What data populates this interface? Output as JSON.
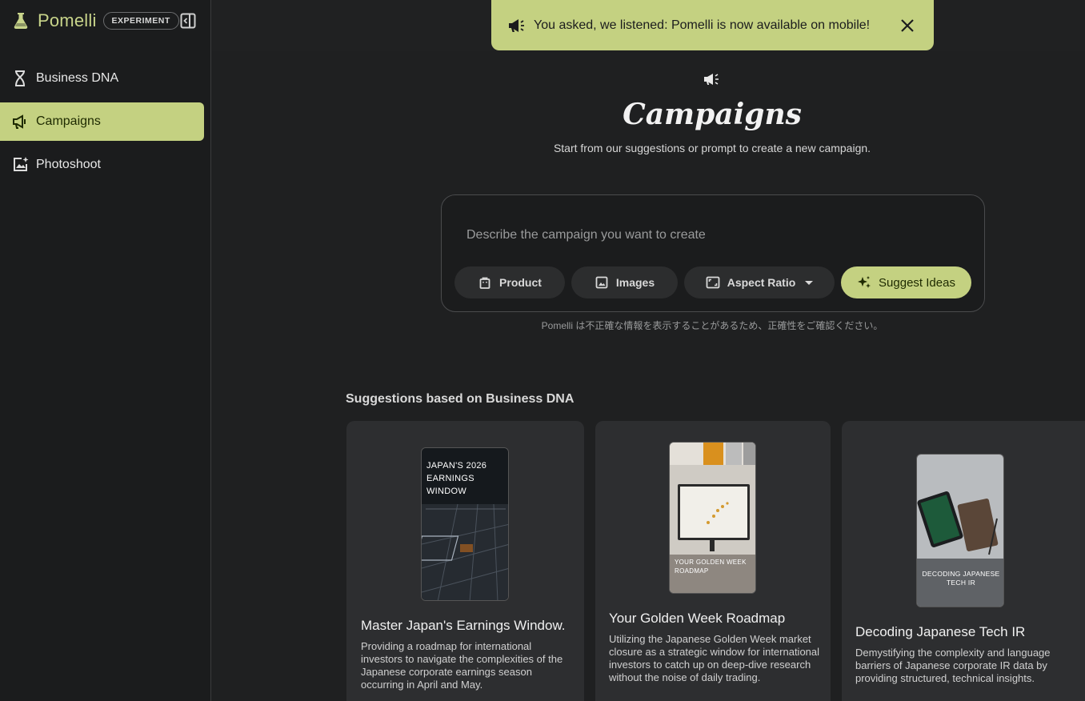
{
  "app": {
    "name": "Pomelli",
    "badge": "EXPERIMENT",
    "brand_color": "#c4d181"
  },
  "sidebar": {
    "items": [
      {
        "label": "Business DNA",
        "icon": "dna-icon",
        "active": false
      },
      {
        "label": "Campaigns",
        "icon": "megaphone-icon",
        "active": true
      },
      {
        "label": "Photoshoot",
        "icon": "photo-sparkle-icon",
        "active": false
      }
    ]
  },
  "toast": {
    "message": "You asked, we listened: Pomelli is now available on mobile!",
    "icon": "megaphone-icon",
    "close_icon": "close-icon"
  },
  "hero": {
    "title": "Campaigns",
    "subtitle": "Start from our suggestions or prompt to create a new campaign."
  },
  "prompt": {
    "placeholder": "Describe the campaign you want to create",
    "value": "",
    "chips": {
      "product": "Product",
      "images": "Images",
      "aspect_ratio": "Aspect Ratio",
      "suggest": "Suggest Ideas"
    }
  },
  "disclaimer": "Pomelli は不正確な情報を表示することがあるため、正確性をご確認ください。",
  "suggestions": {
    "heading": "Suggestions based on Business DNA",
    "cards": [
      {
        "title": "Master Japan's Earnings Window.",
        "description": "Providing a roadmap for international investors to navigate the complexities of the Japanese corporate earnings season occurring in April and May.",
        "thumb_text": "JAPAN'S 2026 EARNINGS WINDOW"
      },
      {
        "title": "Your Golden Week Roadmap",
        "description": "Utilizing the Japanese Golden Week market closure as a strategic window for international investors to catch up on deep-dive research without the noise of daily trading.",
        "thumb_text": "YOUR GOLDEN WEEK ROADMAP"
      },
      {
        "title": "Decoding Japanese Tech IR",
        "description": "Demystifying the complexity and language barriers of Japanese corporate IR data by providing structured, technical insights.",
        "thumb_text": "DECODING JAPANESE TECH IR"
      }
    ]
  }
}
